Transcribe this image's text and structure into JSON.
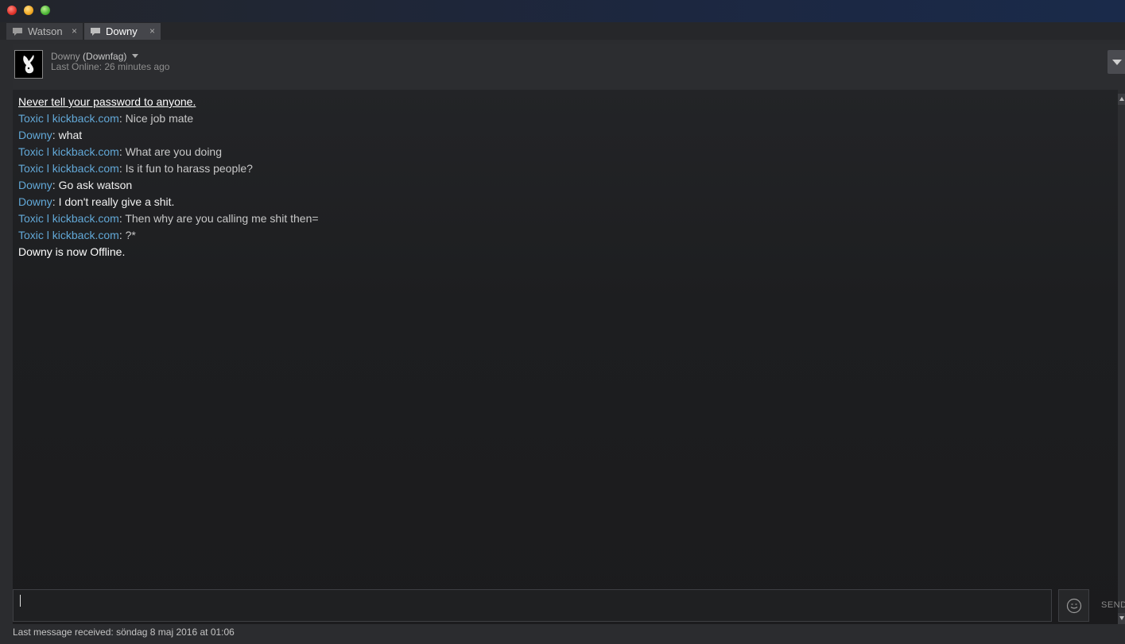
{
  "window": {
    "buttons": [
      "close",
      "minimize",
      "zoom"
    ]
  },
  "tabs": [
    {
      "label": "Watson",
      "active": false,
      "icon": "chat-bubble-icon",
      "close": "×"
    },
    {
      "label": "Downy",
      "active": true,
      "icon": "chat-bubble-icon",
      "close": "×"
    }
  ],
  "header": {
    "name": "Downy",
    "nickname": "(Downfag)",
    "last_online": "Last Online: 26 minutes ago",
    "options_icon": "chevron-down-icon"
  },
  "chat": {
    "warning": "Never tell your password to anyone.",
    "messages": [
      {
        "sender": "Toxic l kickback.com",
        "text": "Nice job mate"
      },
      {
        "sender": "Downy",
        "text": "what"
      },
      {
        "sender": "Toxic l kickback.com",
        "text": "What are you doing"
      },
      {
        "sender": "Toxic l kickback.com",
        "text": "Is it fun to harass people?"
      },
      {
        "sender": "Downy",
        "text": "Go ask watson"
      },
      {
        "sender": "Downy",
        "text": "I don't really give a shit."
      },
      {
        "sender": "Toxic l kickback.com",
        "text": "Then why are you calling me shit then="
      },
      {
        "sender": "Toxic l kickback.com",
        "text": "?*"
      }
    ],
    "offline_notice": "Downy is now Offline."
  },
  "composer": {
    "input_value": "",
    "emoticon_icon": "smiley-icon",
    "send_label": "SEND"
  },
  "status": {
    "last_message": "Last message received: söndag 8 maj 2016 at 01:06"
  },
  "colors": {
    "sender_link": "#62a8d7",
    "background": "#1d1e20"
  }
}
